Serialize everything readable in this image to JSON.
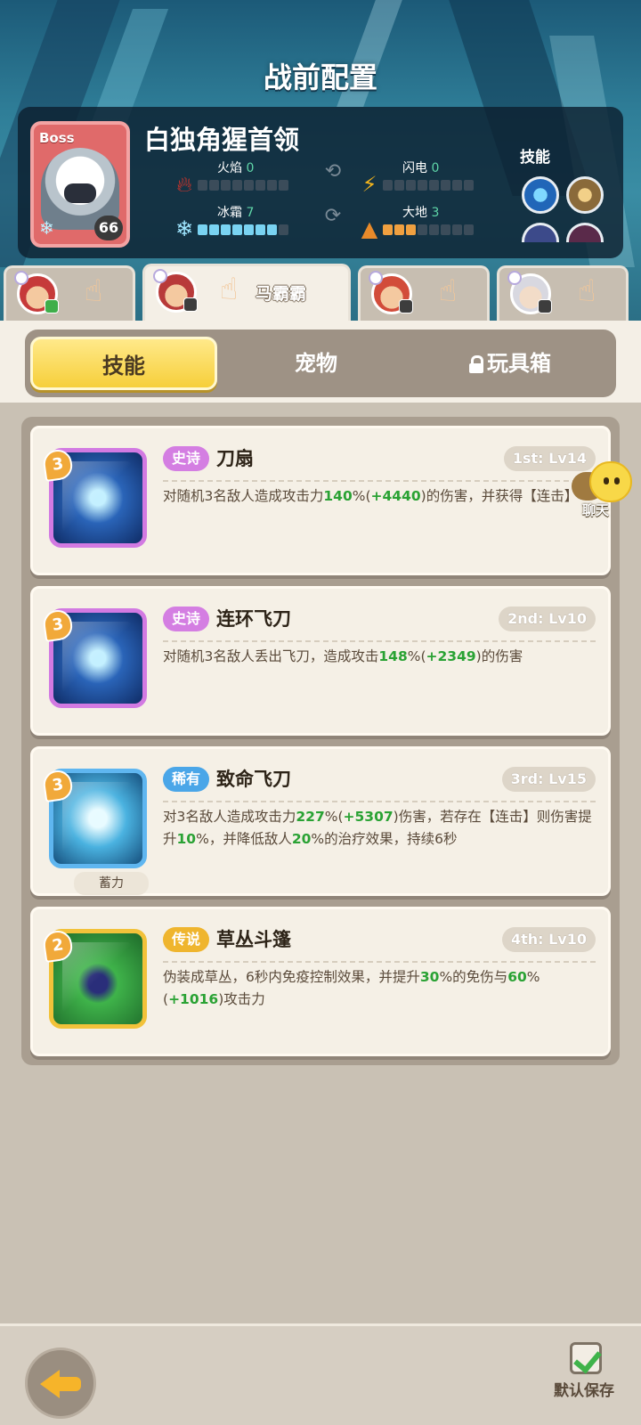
{
  "header": {
    "title": "战前配置"
  },
  "boss": {
    "tag": "Boss",
    "level": "66",
    "name": "白独角猩首领",
    "skills_label": "技能",
    "stats": {
      "fire": {
        "label": "火焰",
        "value": "0",
        "filled": 0
      },
      "thunder": {
        "label": "闪电",
        "value": "0",
        "filled": 0
      },
      "ice": {
        "label": "冰霜",
        "value": "7",
        "filled": 7
      },
      "earth": {
        "label": "大地",
        "value": "3",
        "filled": 3
      }
    }
  },
  "heroes": {
    "active_name": "马霸霸"
  },
  "tabs": {
    "skills": "技能",
    "pets": "宠物",
    "toys": "玩具箱"
  },
  "skills": [
    {
      "level": "3",
      "rarity": "史诗",
      "name": "刀扇",
      "slot": "1st: Lv14",
      "desc_parts": [
        "对随机3名敌人造成攻击力",
        "140",
        "%(",
        "+4440",
        ")的伤害，并获得【连击】"
      ]
    },
    {
      "level": "3",
      "rarity": "史诗",
      "name": "连环飞刀",
      "slot": "2nd: Lv10",
      "desc_parts": [
        "对随机3名敌人丢出飞刀，造成攻击",
        "148",
        "%(",
        "+2349",
        ")的伤害"
      ]
    },
    {
      "level": "3",
      "rarity": "稀有",
      "name": "致命飞刀",
      "slot": "3rd: Lv15",
      "charge": "蓄力",
      "desc_parts": [
        "对3名敌人造成攻击力",
        "227",
        "%(",
        "+5307",
        ")伤害，若存在【连击】则伤害提升",
        "10",
        "%，并降低敌人",
        "20",
        "%的治疗效果，持续6秒"
      ]
    },
    {
      "level": "2",
      "rarity": "传说",
      "name": "草丛斗篷",
      "slot": "4th: Lv10",
      "desc_parts": [
        "伪装成草丛，6秒内免疫控制效果，并提升",
        "30",
        "%的免伤与",
        "60",
        "%(",
        "+1016",
        ")攻击力"
      ]
    }
  ],
  "chat": {
    "label": "聊天"
  },
  "footer": {
    "save_label": "默认保存"
  }
}
